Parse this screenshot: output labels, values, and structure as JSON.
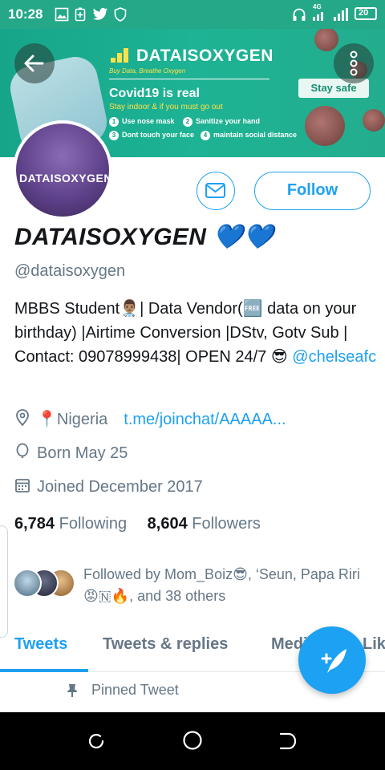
{
  "status_bar": {
    "time": "10:28",
    "network": "4G",
    "battery": "20",
    "icons": [
      "gallery-icon",
      "battery-saver-icon",
      "twitter-icon",
      "shield-icon",
      "headphones-icon",
      "signal-icon",
      "battery-icon"
    ]
  },
  "banner": {
    "brand": "DATAISOXYGEN",
    "tagline": "Buy Data, Breathe Oxygen",
    "headline": "Covid19 is real",
    "subline": "Stay indoor & if you must go out",
    "tips": [
      {
        "num": "1",
        "text": "Use nose mask"
      },
      {
        "num": "2",
        "text": "Sanitize your hand"
      },
      {
        "num": "3",
        "text": "Dont touch your face"
      },
      {
        "num": "4",
        "text": "maintain social distance"
      }
    ],
    "badge": "Stay safe"
  },
  "avatar": {
    "text": "DATAISOXYGEN"
  },
  "actions": {
    "follow_label": "Follow"
  },
  "profile": {
    "display_name": "DATAISOXYGEN 💙💙",
    "handle": "@dataisoxygen",
    "bio_text": "MBBS Student👨🏽‍⚕️| Data Vendor(🆓 data on your birthday) |Airtime Conversion |DStv, Gotv Sub | Contact: 09078999438| OPEN 24/7 😎 ",
    "bio_mention": "@chelseafc",
    "location": "📍Nigeria",
    "website": "t.me/joinchat/AAAAA...",
    "birthday": "Born May 25",
    "joined": "Joined December 2017"
  },
  "stats": {
    "following_count": "6,784",
    "following_label": "Following",
    "followers_count": "8,604",
    "followers_label": "Followers"
  },
  "followed_by": "Followed by Mom_Boiz😎, ‘Seun, Papa Riri 😡🇳🔥, and 38 others",
  "tabs": [
    "Tweets",
    "Tweets & replies",
    "Media",
    "Likes"
  ],
  "pinned_label": "Pinned Tweet",
  "colors": {
    "accent": "#1da1f2",
    "banner": "#1fab8e",
    "text": "#14171a",
    "muted": "#657786"
  }
}
